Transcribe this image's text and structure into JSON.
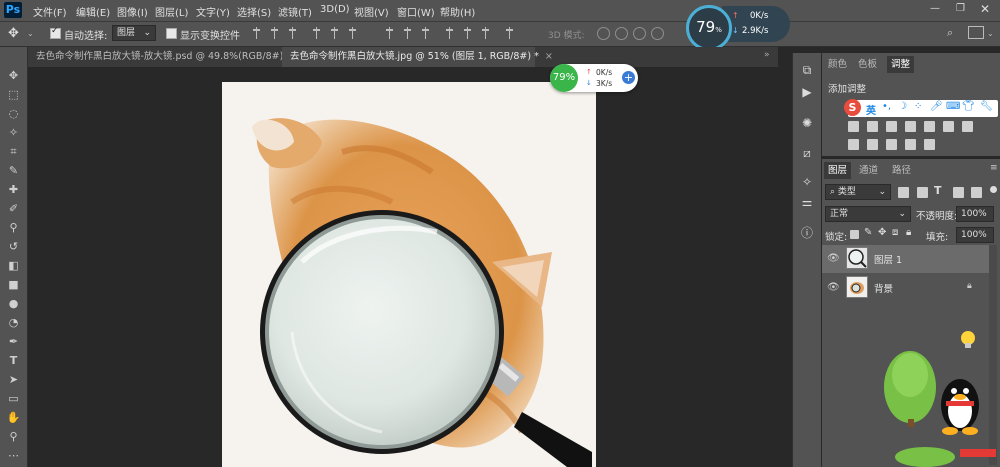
{
  "app": {
    "logo": "Ps"
  },
  "menu": [
    "文件(F)",
    "编辑(E)",
    "图像(I)",
    "图层(L)",
    "文字(Y)",
    "选择(S)",
    "滤镜(T)",
    "3D(D)",
    "视图(V)",
    "窗口(W)",
    "帮助(H)"
  ],
  "options": {
    "auto_select_label": "自动选择:",
    "auto_select_value": "图层",
    "show_transform_label": "显示变换控件",
    "mode_3d_label": "3D 模式:"
  },
  "perf": {
    "big_percent": "79",
    "big_percent_suffix": "%",
    "up_rate": "0K/s",
    "down_rate": "2.9K/s",
    "small_percent": "79%",
    "small_up": "0K/s",
    "small_down": "3K/s"
  },
  "tabs": [
    {
      "label": "去色命令制作黑白放大镜-放大镜.psd @ 49.8%(RGB/8#)",
      "close": "×"
    },
    {
      "label": "去色命令制作黑白放大镜.jpg @ 51% (图层 1, RGB/8#) *",
      "close": "×"
    }
  ],
  "panels": {
    "top_tabs": [
      "颜色",
      "色板",
      "调整"
    ],
    "adjust_title": "添加调整",
    "ime_label": "英",
    "layer_tabs": [
      "图层",
      "通道",
      "路径"
    ],
    "filter_kind": "类型",
    "blend_mode": "正常",
    "opacity_label": "不透明度:",
    "opacity_value": "100%",
    "lock_label": "锁定:",
    "fill_label": "填充:",
    "fill_value": "100%",
    "layers": [
      {
        "name": "图层 1",
        "selected": true
      },
      {
        "name": "背景",
        "selected": false
      }
    ]
  }
}
